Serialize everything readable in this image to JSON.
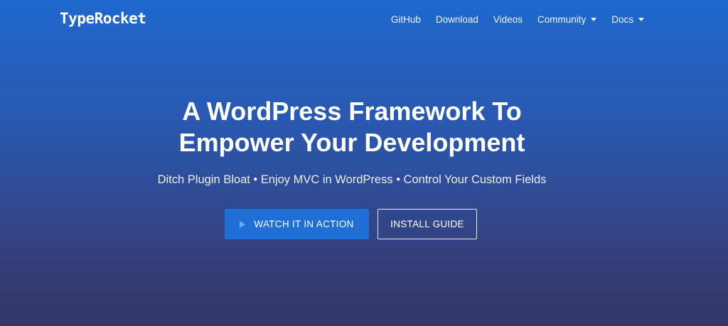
{
  "header": {
    "logo_text": "TypeRocket",
    "nav": [
      {
        "label": "GitHub",
        "dropdown": false
      },
      {
        "label": "Download",
        "dropdown": false
      },
      {
        "label": "Videos",
        "dropdown": false
      },
      {
        "label": "Community",
        "dropdown": true
      },
      {
        "label": "Docs",
        "dropdown": true
      }
    ]
  },
  "hero": {
    "headline_line1": "A WordPress Framework To",
    "headline_line2": "Empower Your Development",
    "tagline": "Ditch Plugin Bloat • Enjoy MVC in WordPress • Control Your Custom Fields",
    "primary_button": {
      "label": "WATCH IT IN ACTION",
      "icon": "play-icon"
    },
    "secondary_button": {
      "label": "INSTALL GUIDE"
    }
  },
  "colors": {
    "gradient_top": "#1e68cd",
    "gradient_bottom": "#343666",
    "primary_button": "#1f6fd6",
    "play_icon": "#5fb0ff"
  }
}
